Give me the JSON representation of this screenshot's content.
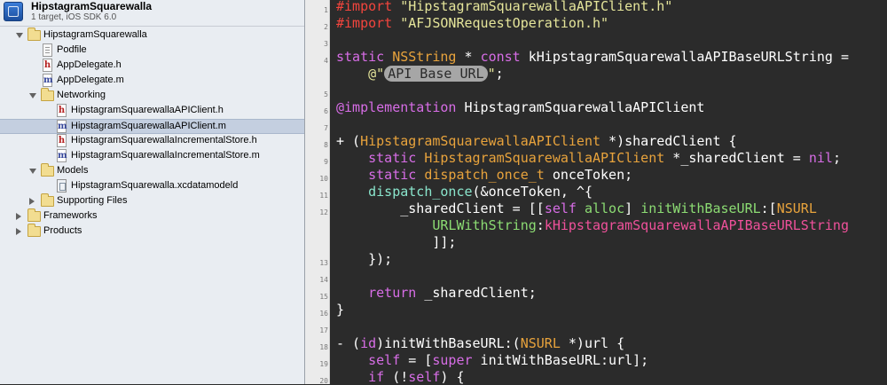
{
  "project": {
    "name": "HipstagramSquarewalla",
    "subtitle": "1 target, iOS SDK 6.0"
  },
  "navigator": {
    "items": [
      {
        "label": "HipstagramSquarewalla",
        "type": "folder",
        "disclosure": "open",
        "level": 1
      },
      {
        "label": "Podfile",
        "type": "doc",
        "level": 2
      },
      {
        "label": "AppDelegate.h",
        "type": "h",
        "level": 2
      },
      {
        "label": "AppDelegate.m",
        "type": "m",
        "level": 2
      },
      {
        "label": "Networking",
        "type": "folder",
        "disclosure": "open",
        "level": 2
      },
      {
        "label": "HipstagramSquarewallaAPIClient.h",
        "type": "h",
        "level": 3
      },
      {
        "label": "HipstagramSquarewallaAPIClient.m",
        "type": "m",
        "level": 3,
        "selected": true
      },
      {
        "label": "HipstagramSquarewallaIncrementalStore.h",
        "type": "h",
        "level": 3
      },
      {
        "label": "HipstagramSquarewallaIncrementalStore.m",
        "type": "m",
        "level": 3
      },
      {
        "label": "Models",
        "type": "folder",
        "disclosure": "open",
        "level": 2
      },
      {
        "label": "HipstagramSquarewalla.xcdatamodeld",
        "type": "model",
        "level": 3
      },
      {
        "label": "Supporting Files",
        "type": "folder",
        "disclosure": "closed",
        "level": 2
      },
      {
        "label": "Frameworks",
        "type": "folder",
        "disclosure": "closed",
        "level": 1
      },
      {
        "label": "Products",
        "type": "folder",
        "disclosure": "closed",
        "level": 1
      }
    ]
  },
  "gutter": {
    "line_numbers": [
      {
        "n": "1",
        "row": 0
      },
      {
        "n": "2",
        "row": 1
      },
      {
        "n": "3",
        "row": 2
      },
      {
        "n": "4",
        "row": 3
      },
      {
        "n": "5",
        "row": 5
      },
      {
        "n": "6",
        "row": 6
      },
      {
        "n": "7",
        "row": 7
      },
      {
        "n": "8",
        "row": 8
      },
      {
        "n": "9",
        "row": 9
      },
      {
        "n": "10",
        "row": 10
      },
      {
        "n": "11",
        "row": 11
      },
      {
        "n": "12",
        "row": 12
      },
      {
        "n": "13",
        "row": 15
      },
      {
        "n": "14",
        "row": 16
      },
      {
        "n": "15",
        "row": 17
      },
      {
        "n": "16",
        "row": 18
      },
      {
        "n": "17",
        "row": 19
      },
      {
        "n": "18",
        "row": 20
      },
      {
        "n": "19",
        "row": 21
      },
      {
        "n": "20",
        "row": 22
      }
    ]
  },
  "editor": {
    "colors": {
      "background": "#2b2b2b",
      "preprocessor": "#f3453d",
      "string": "#e5e59a",
      "keyword": "#d76de6",
      "type": "#e8a33c",
      "function": "#8ae5cc",
      "method": "#8cdc73",
      "constant": "#f0519b",
      "placeholder": "#a6a6a6"
    },
    "lines": [
      {
        "row": 0,
        "indent": "",
        "tokens": [
          {
            "c": "pp",
            "t": "#import "
          },
          {
            "c": "str",
            "t": "\"HipstagramSquarewallaAPIClient.h\""
          }
        ]
      },
      {
        "row": 1,
        "indent": "",
        "tokens": [
          {
            "c": "pp",
            "t": "#import "
          },
          {
            "c": "str",
            "t": "\"AFJSONRequestOperation.h\""
          }
        ]
      },
      {
        "row": 3,
        "indent": "",
        "tokens": [
          {
            "c": "kw",
            "t": "static"
          },
          {
            "c": "p",
            "t": " "
          },
          {
            "c": "ty",
            "t": "NSString"
          },
          {
            "c": "p",
            "t": " * "
          },
          {
            "c": "kw",
            "t": "const"
          },
          {
            "c": "p",
            "t": " kHipstagramSquarewallaAPIBaseURLString = "
          }
        ]
      },
      {
        "row": 4,
        "indent": "    ",
        "tokens": [
          {
            "c": "str",
            "t": "@\""
          },
          {
            "c": "tok",
            "t": "API Base URL"
          },
          {
            "c": "str",
            "t": "\""
          },
          {
            "c": "p",
            "t": ";"
          }
        ]
      },
      {
        "row": 6,
        "indent": "",
        "tokens": [
          {
            "c": "kw",
            "t": "@implementation"
          },
          {
            "c": "p",
            "t": " HipstagramSquarewallaAPIClient"
          }
        ]
      },
      {
        "row": 8,
        "indent": "",
        "tokens": [
          {
            "c": "p",
            "t": "+ ("
          },
          {
            "c": "cls",
            "t": "HipstagramSquarewallaAPIClient"
          },
          {
            "c": "p",
            "t": " *)sharedClient {"
          }
        ]
      },
      {
        "row": 9,
        "indent": "    ",
        "tokens": [
          {
            "c": "kw",
            "t": "static"
          },
          {
            "c": "p",
            "t": " "
          },
          {
            "c": "cls",
            "t": "HipstagramSquarewallaAPIClient"
          },
          {
            "c": "p",
            "t": " *_sharedClient = "
          },
          {
            "c": "kw",
            "t": "nil"
          },
          {
            "c": "p",
            "t": ";"
          }
        ]
      },
      {
        "row": 10,
        "indent": "    ",
        "tokens": [
          {
            "c": "kw",
            "t": "static"
          },
          {
            "c": "p",
            "t": " "
          },
          {
            "c": "ty",
            "t": "dispatch_once_t"
          },
          {
            "c": "p",
            "t": " onceToken;"
          }
        ]
      },
      {
        "row": 11,
        "indent": "    ",
        "tokens": [
          {
            "c": "fn",
            "t": "dispatch_once"
          },
          {
            "c": "p",
            "t": "(&onceToken, ^{"
          }
        ]
      },
      {
        "row": 12,
        "indent": "        ",
        "tokens": [
          {
            "c": "p",
            "t": "_sharedClient = [["
          },
          {
            "c": "kw",
            "t": "self"
          },
          {
            "c": "p",
            "t": " "
          },
          {
            "c": "mth",
            "t": "alloc"
          },
          {
            "c": "p",
            "t": "] "
          },
          {
            "c": "mth",
            "t": "initWithBaseURL"
          },
          {
            "c": "p",
            "t": ":["
          },
          {
            "c": "ty",
            "t": "NSURL"
          }
        ]
      },
      {
        "row": 13,
        "indent": "            ",
        "tokens": [
          {
            "c": "mth",
            "t": "URLWithString"
          },
          {
            "c": "p",
            "t": ":"
          },
          {
            "c": "kc",
            "t": "kHipstagramSquarewallaAPIBaseURLString"
          }
        ]
      },
      {
        "row": 14,
        "indent": "            ",
        "tokens": [
          {
            "c": "p",
            "t": "]];"
          }
        ]
      },
      {
        "row": 15,
        "indent": "    ",
        "tokens": [
          {
            "c": "p",
            "t": "});"
          }
        ]
      },
      {
        "row": 17,
        "indent": "    ",
        "tokens": [
          {
            "c": "kw",
            "t": "return"
          },
          {
            "c": "p",
            "t": " _sharedClient;"
          }
        ]
      },
      {
        "row": 18,
        "indent": "",
        "tokens": [
          {
            "c": "p",
            "t": "}"
          }
        ]
      },
      {
        "row": 20,
        "indent": "",
        "tokens": [
          {
            "c": "p",
            "t": "- ("
          },
          {
            "c": "kw",
            "t": "id"
          },
          {
            "c": "p",
            "t": ")initWithBaseURL:("
          },
          {
            "c": "ty",
            "t": "NSURL"
          },
          {
            "c": "p",
            "t": " *)url {"
          }
        ]
      },
      {
        "row": 21,
        "indent": "    ",
        "tokens": [
          {
            "c": "kw",
            "t": "self"
          },
          {
            "c": "p",
            "t": " = ["
          },
          {
            "c": "kw",
            "t": "super"
          },
          {
            "c": "p",
            "t": " initWithBaseURL:url];"
          }
        ]
      },
      {
        "row": 22,
        "indent": "    ",
        "tokens": [
          {
            "c": "kw",
            "t": "if"
          },
          {
            "c": "p",
            "t": " (!"
          },
          {
            "c": "kw",
            "t": "self"
          },
          {
            "c": "p",
            "t": ") {"
          }
        ]
      }
    ]
  }
}
